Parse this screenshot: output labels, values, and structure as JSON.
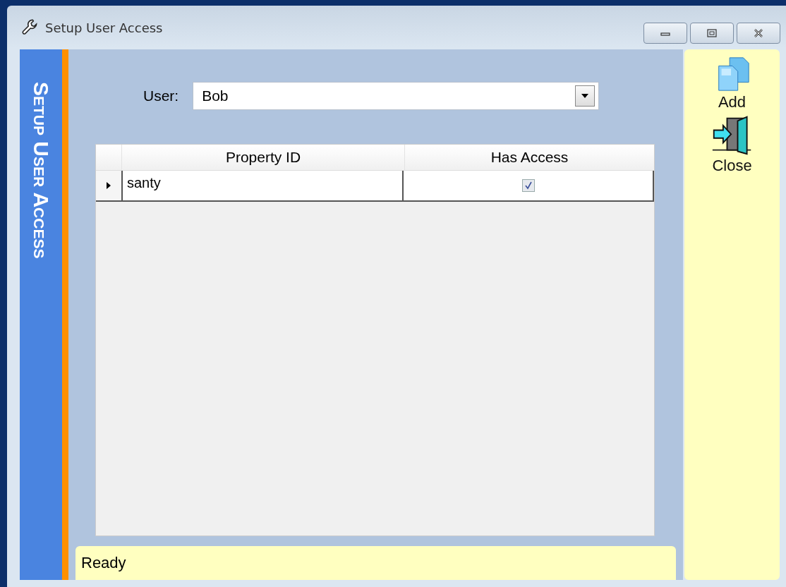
{
  "window": {
    "title": "Setup User Access"
  },
  "sidebar": {
    "title": "Setup User Access"
  },
  "user_field": {
    "label": "User:",
    "value": "Bob"
  },
  "table": {
    "columns": [
      "Property ID",
      "Has Access"
    ],
    "rows": [
      {
        "property_id": "santy",
        "has_access": true,
        "selected": true
      }
    ]
  },
  "actions": [
    {
      "kind": "add",
      "label": "Add"
    },
    {
      "kind": "close",
      "label": "Close"
    }
  ],
  "status_bar": "Ready"
}
